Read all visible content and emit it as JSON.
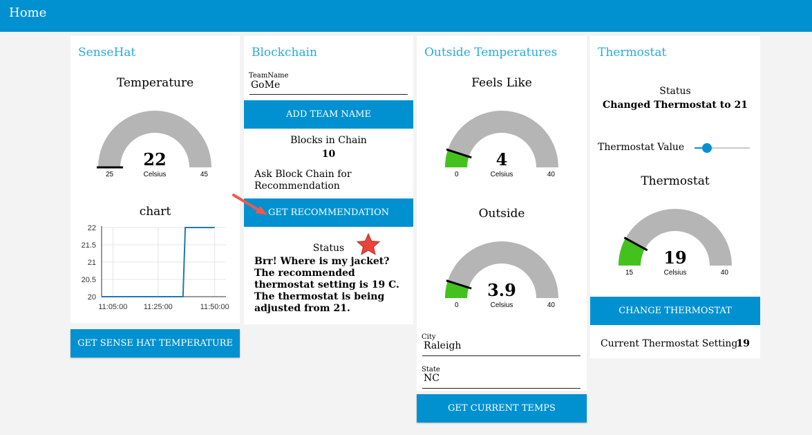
{
  "header": {
    "title": "Home"
  },
  "colors": {
    "accent": "#0191d0",
    "title": "#29a9e1",
    "gauge_bg": "#b5b5b5",
    "gauge_fill": "#43c21d",
    "line": "#1f77b4"
  },
  "sensehat": {
    "title": "SenseHat",
    "gauge": {
      "label": "Temperature",
      "value": "22",
      "value_num": 22,
      "unit": "Celsius",
      "min": "25",
      "max": "45",
      "min_num": 25,
      "max_num": 45
    },
    "chart_title": "chart",
    "button": "GET SENSE HAT TEMPERATURE"
  },
  "chart_data": {
    "type": "line",
    "title": "chart",
    "x": [
      "11:00:00",
      "11:05:00",
      "11:25:00",
      "11:36:00",
      "11:37:00",
      "11:50:00"
    ],
    "x_ticks": [
      "11:05:00",
      "11:25:00",
      "11:50:00"
    ],
    "y_ticks": [
      "22",
      "21.5",
      "21",
      "20.5",
      "20"
    ],
    "series": [
      {
        "values": [
          20,
          20,
          20,
          20,
          22,
          22
        ]
      }
    ],
    "ylim": [
      20,
      22
    ],
    "grid": true
  },
  "blockchain": {
    "title": "Blockchain",
    "team_label": "TeamName",
    "team_value": "GoMe",
    "add_button": "ADD TEAM NAME",
    "blocks_label": "Blocks in Chain",
    "blocks_value": "10",
    "ask_text": "Ask Block Chain for Recommendation",
    "rec_button": "GET RECOMMENDATION",
    "status_label": "Status",
    "status_text": "Brr! Where is my jacket? The recommended thermostat setting is 19 C. The thermostat is being adjusted from 21."
  },
  "outside": {
    "title": "Outside Temperatures",
    "feels": {
      "label": "Feels Like",
      "value": "4",
      "value_num": 4,
      "unit": "Celsius",
      "min": "0",
      "max": "40",
      "min_num": 0,
      "max_num": 40
    },
    "outside": {
      "label": "Outside",
      "value": "3.9",
      "value_num": 3.9,
      "unit": "Celsius",
      "min": "0",
      "max": "40",
      "min_num": 0,
      "max_num": 40
    },
    "city_label": "City",
    "city_value": "Raleigh",
    "state_label": "State",
    "state_value": "NC",
    "button": "GET CURRENT TEMPS"
  },
  "thermostat": {
    "title": "Thermostat",
    "status_label": "Status",
    "status_value": "Changed Thermostat to 21",
    "slider_label": "Thermostat Value",
    "slider_fraction": 0.22,
    "gauge": {
      "label": "Thermostat",
      "value": "19",
      "value_num": 19,
      "unit": "Celsius",
      "min": "15",
      "max": "40",
      "min_num": 15,
      "max_num": 40
    },
    "button": "CHANGE THERMOSTAT",
    "current_label": "Current Thermostat Setting",
    "current_value": "19"
  }
}
